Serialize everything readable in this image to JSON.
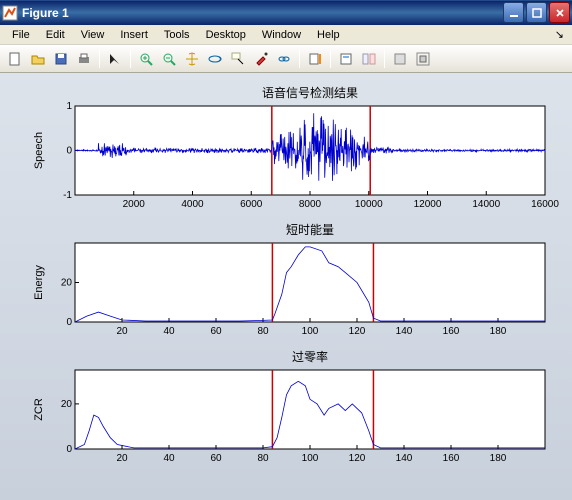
{
  "window": {
    "title": "Figure 1"
  },
  "menu": {
    "file": "File",
    "edit": "Edit",
    "view": "View",
    "insert": "Insert",
    "tools": "Tools",
    "desktop": "Desktop",
    "window": "Window",
    "help": "Help"
  },
  "toolbar_icons": [
    "new",
    "open",
    "save",
    "print",
    "arrow",
    "zoomin",
    "zoomout",
    "pan",
    "rotate",
    "datacursor",
    "brush",
    "link",
    "colorbar",
    "legend",
    "hide",
    "undock"
  ],
  "subplot1": {
    "title": "语音信号检测结果",
    "ylabel": "Speech",
    "yticks": [
      "-1",
      "0",
      "1"
    ],
    "xticks": [
      "2000",
      "4000",
      "6000",
      "8000",
      "10000",
      "12000",
      "14000",
      "16000"
    ],
    "xlim": [
      0,
      16000
    ],
    "ylim": [
      -1,
      1
    ],
    "markers": [
      6700,
      10050
    ]
  },
  "subplot2": {
    "title": "短时能量",
    "ylabel": "Energy",
    "yticks": [
      "0",
      "20"
    ],
    "xticks": [
      "20",
      "40",
      "60",
      "80",
      "100",
      "120",
      "140",
      "160",
      "180"
    ],
    "xlim": [
      0,
      200
    ],
    "ylim": [
      0,
      40
    ],
    "markers": [
      84,
      127
    ]
  },
  "subplot3": {
    "title": "过零率",
    "ylabel": "ZCR",
    "yticks": [
      "0",
      "20"
    ],
    "xticks": [
      "20",
      "40",
      "60",
      "80",
      "100",
      "120",
      "140",
      "160",
      "180"
    ],
    "xlim": [
      0,
      200
    ],
    "ylim": [
      0,
      35
    ],
    "markers": [
      84,
      127
    ]
  },
  "chart_data": [
    {
      "type": "line",
      "title": "语音信号检测结果",
      "xlabel": "",
      "ylabel": "Speech",
      "xlim": [
        0,
        16000
      ],
      "ylim": [
        -1,
        1
      ],
      "note": "raw speech waveform; quiet noise ~[-0.1,0.1] outside [6700,10050], burst up to ~[-1,1] inside",
      "vad_endpoints": [
        6700,
        10050
      ]
    },
    {
      "type": "line",
      "title": "短时能量",
      "xlabel": "",
      "ylabel": "Energy",
      "xlim": [
        0,
        200
      ],
      "ylim": [
        0,
        40
      ],
      "x": [
        0,
        5,
        10,
        15,
        20,
        30,
        40,
        50,
        60,
        70,
        80,
        84,
        85,
        88,
        90,
        92,
        95,
        98,
        100,
        105,
        108,
        112,
        115,
        120,
        125,
        127,
        130,
        140,
        160,
        180,
        200
      ],
      "y": [
        0,
        3,
        5,
        3,
        1,
        0.5,
        0.5,
        0.5,
        0.5,
        0.5,
        0.8,
        1,
        4,
        14,
        25,
        28,
        34,
        38,
        38,
        36,
        30,
        28,
        25,
        20,
        10,
        2,
        0.5,
        0.5,
        0.5,
        0.5,
        0.5
      ],
      "vad_endpoints": [
        84,
        127
      ]
    },
    {
      "type": "line",
      "title": "过零率",
      "xlabel": "",
      "ylabel": "ZCR",
      "xlim": [
        0,
        200
      ],
      "ylim": [
        0,
        35
      ],
      "x": [
        0,
        4,
        6,
        8,
        10,
        12,
        15,
        18,
        25,
        40,
        60,
        80,
        84,
        86,
        88,
        90,
        92,
        95,
        98,
        100,
        103,
        106,
        108,
        112,
        115,
        118,
        122,
        125,
        127,
        130,
        140,
        160,
        180,
        200
      ],
      "y": [
        0,
        2,
        8,
        15,
        14,
        10,
        5,
        2,
        0.5,
        0.5,
        0.5,
        0.5,
        1,
        5,
        14,
        24,
        28,
        30,
        28,
        22,
        20,
        15,
        18,
        20,
        17,
        20,
        16,
        8,
        2,
        0.5,
        0.5,
        0.5,
        0.5,
        0.5
      ],
      "vad_endpoints": [
        84,
        127
      ]
    }
  ]
}
